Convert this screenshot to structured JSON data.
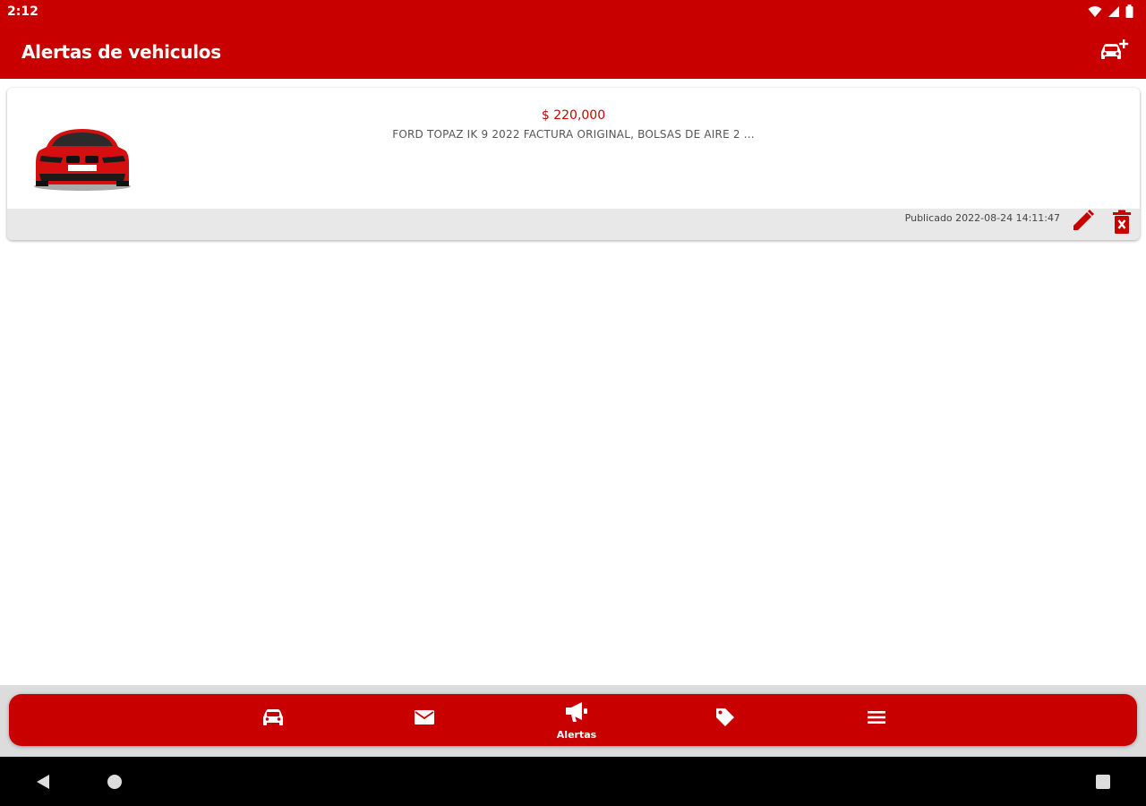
{
  "status_bar": {
    "time": "2:12",
    "icons": [
      "wifi-icon",
      "signal-icon",
      "battery-icon"
    ]
  },
  "app_bar": {
    "title": "Alertas de vehiculos",
    "action_icon": "add-car-icon"
  },
  "alerts": [
    {
      "price": "$ 220,000",
      "description": "FORD TOPAZ IK 9 2022 FACTURA ORIGINAL, BOLSAS DE AIRE 2 ...",
      "published": "Publicado 2022-08-24 14:11:47",
      "image": "red-car-front",
      "actions": [
        "edit-icon",
        "delete-icon"
      ]
    }
  ],
  "bottom_nav": {
    "items": [
      {
        "icon": "car-icon",
        "label": ""
      },
      {
        "icon": "mail-icon",
        "label": ""
      },
      {
        "icon": "megaphone-icon",
        "label": "Alertas",
        "active": true
      },
      {
        "icon": "tag-icon",
        "label": ""
      },
      {
        "icon": "menu-icon",
        "label": ""
      }
    ]
  },
  "colors": {
    "primary": "#c80000",
    "background": "#ffffff",
    "card_footer": "#e8e8e8",
    "system_nav": "#000000"
  }
}
